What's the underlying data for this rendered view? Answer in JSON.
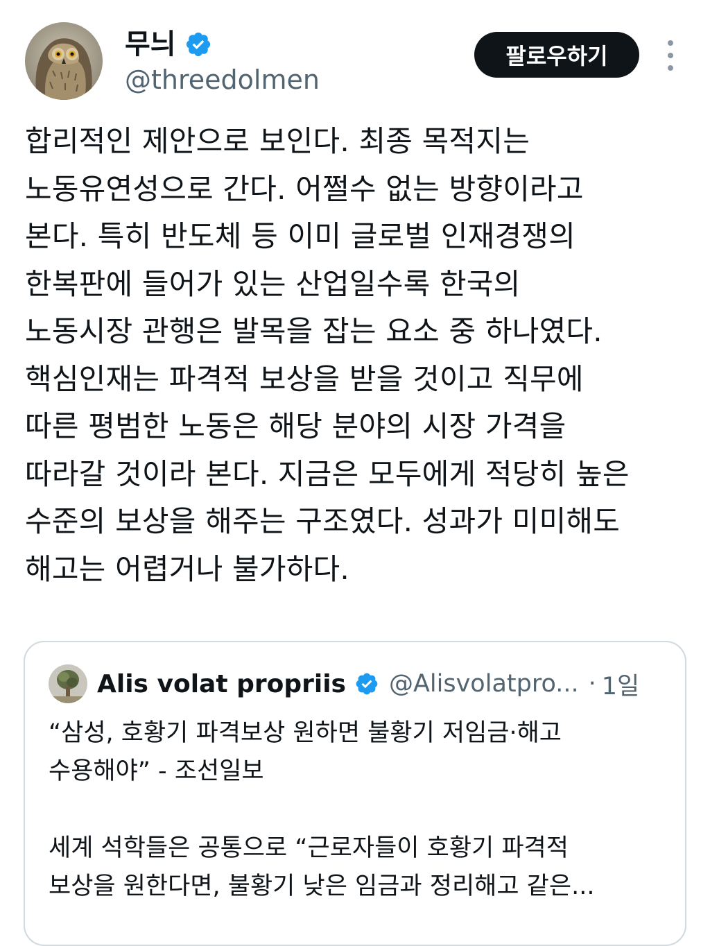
{
  "author": {
    "name": "무늬",
    "handle": "@threedolmen",
    "verified": true,
    "avatar_icon": "owl-avatar"
  },
  "actions": {
    "follow_label": "팔로우하기",
    "more_icon": "more-options-icon"
  },
  "post": {
    "lines": [
      "합리적인 제안으로 보인다. 최종 목적지는",
      "노동유연성으로 간다. 어쩔수 없는 방향이라고",
      "본다. 특히 반도체 등 이미 글로벌 인재경쟁의",
      "한복판에 들어가 있는 산업일수록 한국의",
      "노동시장 관행은 발목을 잡는 요소 중 하나였다.",
      "핵심인재는 파격적 보상을 받을 것이고 직무에",
      "따른 평범한 노동은 해당 분야의 시장 가격을",
      "따라갈 것이라 본다. 지금은 모두에게 적당히 높은",
      "수준의 보상을 해주는 구조였다. 성과가 미미해도",
      "해고는 어렵거나 불가하다."
    ]
  },
  "quote": {
    "name": "Alis volat propriis",
    "handle": "@Alisvolatpro...",
    "separator": "·",
    "time": "1일",
    "verified": true,
    "avatar_icon": "tree-avatar",
    "lines": [
      "“삼성, 호황기 파격보상 원하면 불황기 저임금·해고",
      "수용해야” - 조선일보"
    ],
    "lines2": [
      "세계 석학들은 공통으로 “근로자들이 호황기 파격적",
      "보상을 원한다면, 불황기 낮은 임금과 정리해고 같은..."
    ]
  },
  "colors": {
    "verified_blue": "#1d9bf0",
    "follow_button_bg": "#0f1419",
    "text_primary": "#0f1419",
    "text_secondary": "#536471",
    "card_border": "#cfd9de"
  }
}
